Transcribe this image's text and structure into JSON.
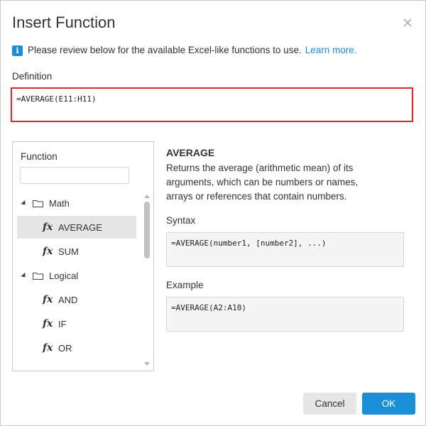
{
  "dialog": {
    "title": "Insert Function",
    "info_text": "Please review below for the available Excel-like functions to use.",
    "info_link": "Learn more.",
    "definition_label": "Definition",
    "definition_value": "=AVERAGE(E11:H11)"
  },
  "function_panel": {
    "label": "Function",
    "search_value": "",
    "tree": [
      {
        "type": "group",
        "label": "Math",
        "icon": "folder-icon"
      },
      {
        "type": "leaf",
        "label": "AVERAGE",
        "icon": "fx-icon",
        "selected": true
      },
      {
        "type": "leaf",
        "label": "SUM",
        "icon": "fx-icon",
        "selected": false
      },
      {
        "type": "group",
        "label": "Logical",
        "icon": "folder-icon"
      },
      {
        "type": "leaf",
        "label": "AND",
        "icon": "fx-icon",
        "selected": false
      },
      {
        "type": "leaf",
        "label": "IF",
        "icon": "fx-icon",
        "selected": false
      },
      {
        "type": "leaf",
        "label": "OR",
        "icon": "fx-icon",
        "selected": false
      }
    ]
  },
  "detail": {
    "name": "AVERAGE",
    "description": "Returns the average (arithmetic mean) of its arguments, which can be numbers or names, arrays or references that contain numbers.",
    "syntax_label": "Syntax",
    "syntax": "=AVERAGE(number1, [number2], ...)",
    "example_label": "Example",
    "example": "=AVERAGE(A2:A10)"
  },
  "buttons": {
    "cancel": "Cancel",
    "ok": "OK"
  },
  "colors": {
    "accent": "#1a8fd6",
    "definition_border": "#d8262c"
  }
}
